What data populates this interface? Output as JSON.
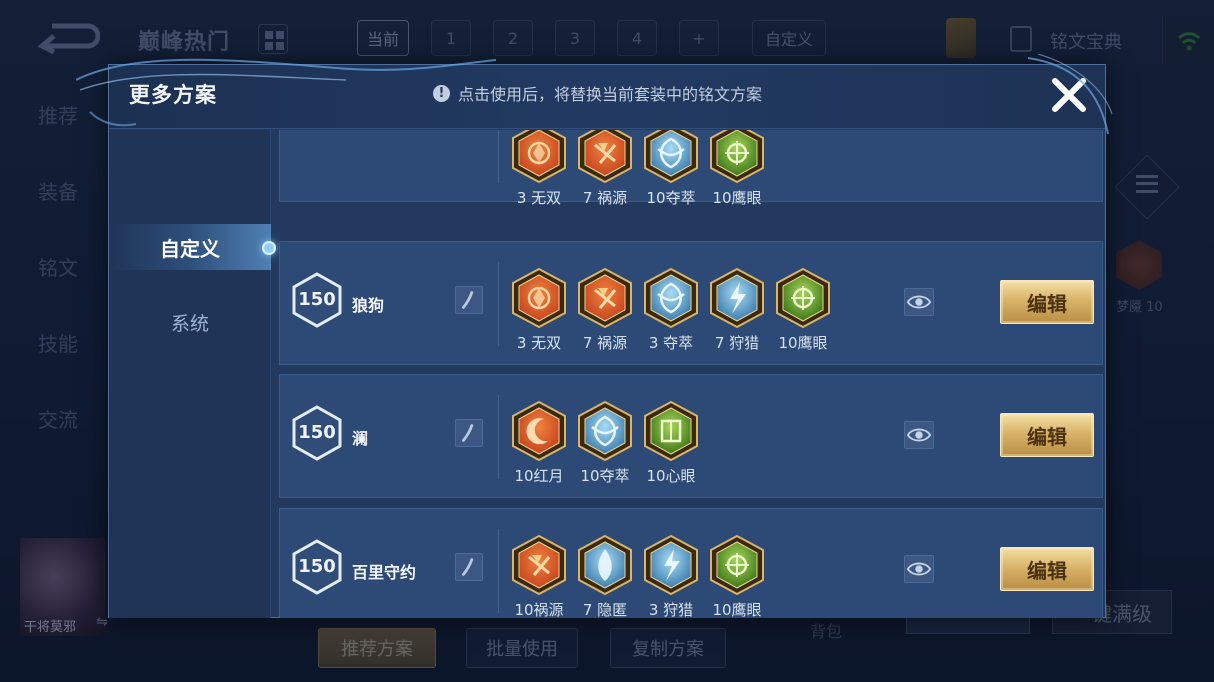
{
  "background": {
    "title": "巅峰热门",
    "slot_tabs": [
      "当前",
      "1",
      "2",
      "3",
      "4",
      "+"
    ],
    "custom_tab": "自定义",
    "codex_label": "铭文宝典",
    "side_nav": [
      "推荐",
      "装备",
      "铭文",
      "技能",
      "交流"
    ],
    "hero_name": "干将莫邪",
    "right_rune_label": "梦魇 10",
    "bottom_buttons": [
      "推荐方案",
      "批量使用",
      "复制方案"
    ],
    "bag_label": "背包",
    "full_level_label": "一键满级"
  },
  "modal": {
    "title": "更多方案",
    "hint_icon": "!",
    "hint": "点击使用后，将替换当前套装中的铭文方案",
    "tabs": [
      {
        "label": "自定义",
        "active": true
      },
      {
        "label": "系统",
        "active": false
      }
    ]
  },
  "plans": [
    {
      "level": "",
      "name": "",
      "runes": [
        {
          "label": "3 无双",
          "type": "red-a"
        },
        {
          "label": "7 祸源",
          "type": "red-b"
        },
        {
          "label": "10夺萃",
          "type": "blue-a"
        },
        {
          "label": "10鹰眼",
          "type": "green-a"
        }
      ],
      "edit_label": ""
    },
    {
      "level": "150",
      "name": "狼狗",
      "runes": [
        {
          "label": "3 无双",
          "type": "red-a"
        },
        {
          "label": "7 祸源",
          "type": "red-b"
        },
        {
          "label": "3 夺萃",
          "type": "blue-a"
        },
        {
          "label": "7 狩猎",
          "type": "blue-b"
        },
        {
          "label": "10鹰眼",
          "type": "green-a"
        }
      ],
      "edit_label": "编辑"
    },
    {
      "level": "150",
      "name": "澜",
      "runes": [
        {
          "label": "10红月",
          "type": "red-c"
        },
        {
          "label": "10夺萃",
          "type": "blue-a"
        },
        {
          "label": "10心眼",
          "type": "green-b"
        }
      ],
      "edit_label": "编辑"
    },
    {
      "level": "150",
      "name": "百里守约",
      "runes": [
        {
          "label": "10祸源",
          "type": "red-b"
        },
        {
          "label": "7 隐匿",
          "type": "blue-c"
        },
        {
          "label": "3 狩猎",
          "type": "blue-b"
        },
        {
          "label": "10鹰眼",
          "type": "green-a"
        }
      ],
      "edit_label": "编辑"
    }
  ],
  "colors": {
    "red": "#c7461f",
    "blue": "#5fa6d6",
    "green": "#6aa72d",
    "gold": "#d9b469"
  }
}
